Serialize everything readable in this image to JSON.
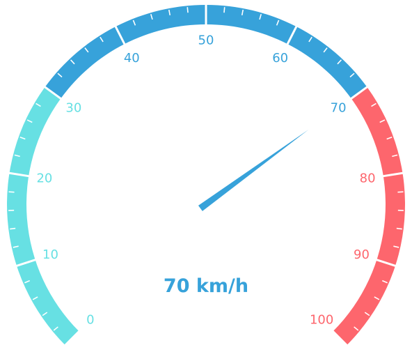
{
  "chart_data": {
    "type": "gauge",
    "min": 0,
    "max": 100,
    "value": 70,
    "unit": "km/h",
    "detail_text": "70 km/h",
    "major_ticks": [
      "0",
      "10",
      "20",
      "30",
      "40",
      "50",
      "60",
      "70",
      "80",
      "90",
      "100"
    ],
    "minor_ticks_per_major": 5,
    "bands": [
      {
        "from": 0,
        "to": 30,
        "color": "#67e0e3"
      },
      {
        "from": 30,
        "to": 70,
        "color": "#37a2da"
      },
      {
        "from": 70,
        "to": 100,
        "color": "#fd666d"
      }
    ],
    "pointer_color": "#37a2da",
    "detail_color": "#37a2da"
  }
}
